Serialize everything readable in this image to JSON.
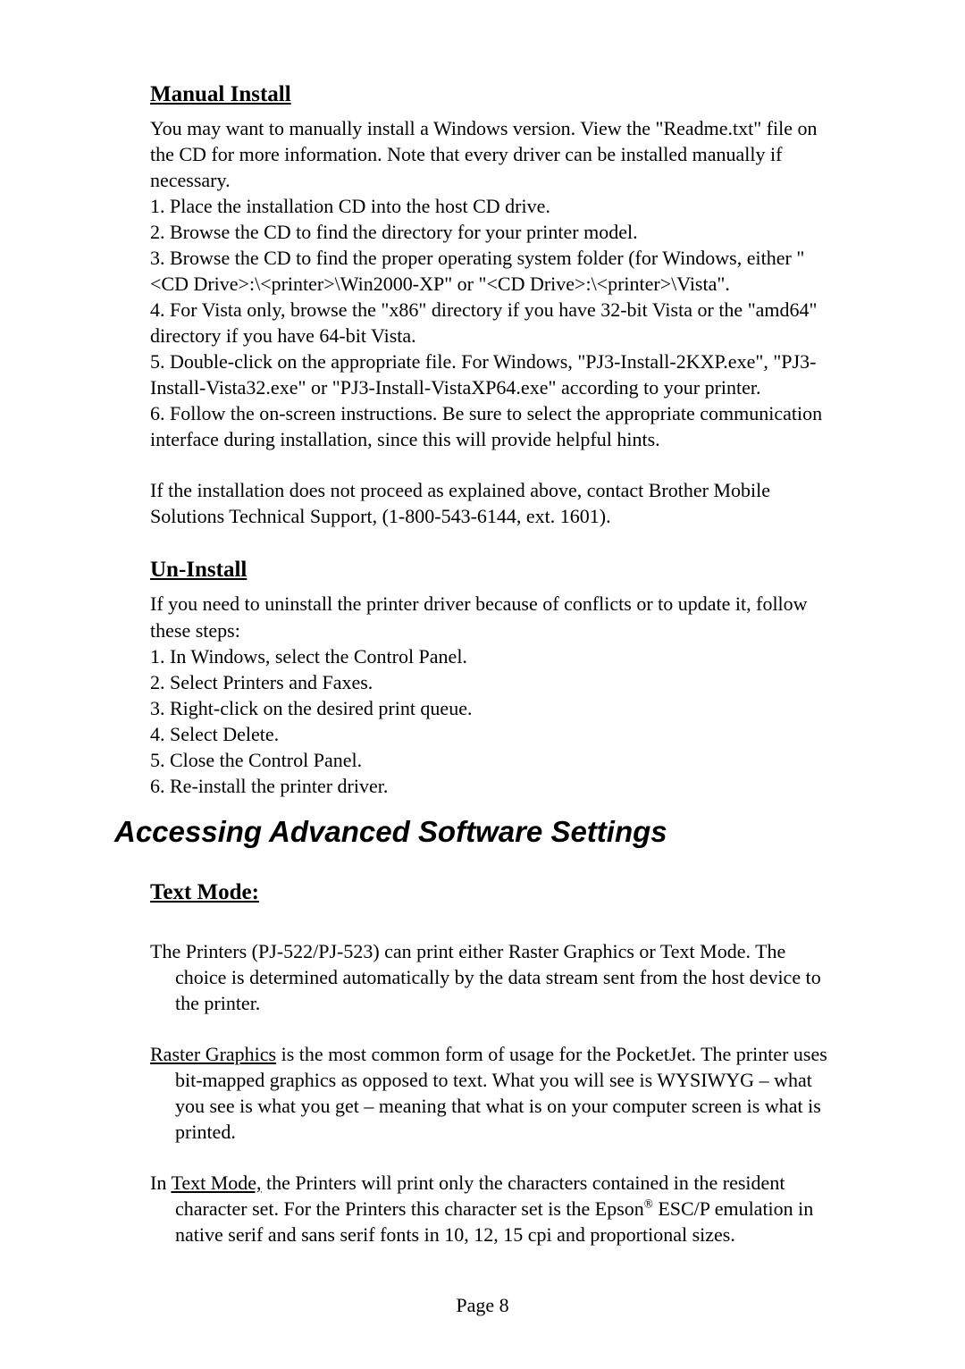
{
  "manual_install": {
    "heading": "Manual Install",
    "intro": "You may want to manually install a Windows version. View the \"Readme.txt\" file on the CD for more information. Note that every driver can be installed manually if necessary.",
    "steps": [
      "1. Place the installation CD into the host CD drive.",
      "2. Browse the CD to find the directory for your printer model.",
      "3. Browse the CD to find the proper operating system folder (for Windows, either \"<CD Drive>:\\<printer>\\Win2000-XP\" or  \"<CD Drive>:\\<printer>\\Vista\".",
      "4. For Vista only, browse the \"x86\" directory if you have 32-bit Vista or the \"amd64\" directory if you have 64-bit Vista.",
      "5. Double-click on the appropriate file. For Windows, \"PJ3-Install-2KXP.exe\", \"PJ3-Install-Vista32.exe\" or \"PJ3-Install-VistaXP64.exe\" according to your printer.",
      "6. Follow the on-screen instructions. Be sure to select the appropriate communication interface during installation, since this will provide helpful hints."
    ],
    "note": "If the installation does not proceed as explained above, contact Brother Mobile Solutions Technical Support, (1-800-543-6144, ext. 1601)."
  },
  "uninstall": {
    "heading": "Un-Install",
    "intro": "If you need to uninstall the printer driver because of conflicts or to update it, follow these steps:",
    "steps": [
      "1. In Windows, select the Control Panel.",
      "2. Select Printers and Faxes.",
      "3. Right-click on the desired print queue.",
      "4. Select Delete.",
      "5. Close the Control Panel.",
      "6. Re-install the printer driver."
    ]
  },
  "advanced_settings": {
    "title": "Accessing Advanced Software Settings",
    "text_mode_heading": "Text Mode:",
    "text_mode_intro": "The Printers (PJ-522/PJ-523) can print either Raster Graphics or Text Mode.  The choice is determined automatically by the data stream sent from the host device to the printer.",
    "raster_label": "Raster Graphics",
    "raster_rest": " is the most common form of usage for the PocketJet.  The printer uses bit-mapped graphics as opposed to text.  What you will see is WYSIWYG – what you see is what you get – meaning that what is on your computer screen is what is printed.",
    "textmode_prefix": "In ",
    "textmode_label": "Text Mode,",
    "textmode_rest_1": " the Printers will print only the characters contained in the resident character set.  For the Printers this character set is the Epson",
    "textmode_reg": "®",
    "textmode_rest_2": " ESC/P emulation in native serif and sans serif fonts in 10, 12, 15 cpi and proportional sizes."
  },
  "footer": {
    "page_label": "Page 8"
  }
}
